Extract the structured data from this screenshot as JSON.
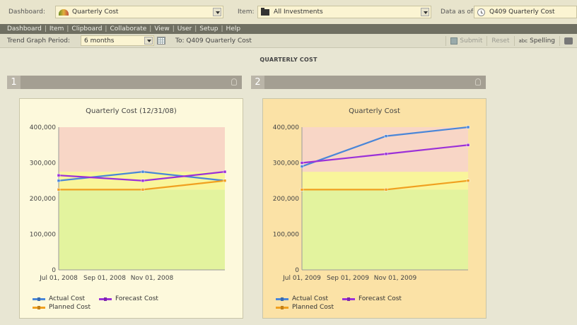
{
  "toolbar": {
    "dashboard_label": "Dashboard:",
    "dashboard_value": "Quarterly Cost",
    "item_label": "Item:",
    "item_value": "All Investments",
    "data_as_of_label": "Data as of:",
    "data_as_of_value": "Q409 Quarterly Cost"
  },
  "menu": [
    "Dashboard",
    "Item",
    "Clipboard",
    "Collaborate",
    "View",
    "User",
    "Setup",
    "Help"
  ],
  "subbar": {
    "trend_label": "Trend Graph Period:",
    "trend_value": "6 months",
    "to_label": "To: Q409 Quarterly Cost",
    "submit": "Submit",
    "reset": "Reset",
    "spelling": "Spelling",
    "spell_icon": "abc"
  },
  "page_title": "QUARTERLY COST",
  "panels": [
    {
      "number": "1"
    },
    {
      "number": "2"
    }
  ],
  "chart_data": [
    {
      "type": "line",
      "title": "Quarterly Cost (12/31/08)",
      "x_tick_labels": [
        "Jul 01, 2008",
        "Sep 01, 2008",
        "Nov 01, 2008"
      ],
      "x_points": [
        "Jul 2008",
        "Sep-Oct 2008",
        "Dec 2008"
      ],
      "ylim": [
        0,
        400000
      ],
      "yticks": [
        "0",
        "100,000",
        "200,000",
        "300,000",
        "400,000"
      ],
      "bands": [
        {
          "name": "green",
          "from": 0,
          "to": 225000,
          "color": "#e3f39e"
        },
        {
          "name": "yellow",
          "from": 225000,
          "to": 275000,
          "color": "#f9f59b"
        },
        {
          "name": "red",
          "from": 275000,
          "to": 400000,
          "color": "#f8d6c6"
        }
      ],
      "series": [
        {
          "name": "Actual Cost",
          "color": "#4a86d8",
          "values": [
            250000,
            275000,
            250000
          ]
        },
        {
          "name": "Forecast Cost",
          "color": "#9b30d8",
          "values": [
            265000,
            250000,
            275000
          ]
        },
        {
          "name": "Planned Cost",
          "color": "#f0a020",
          "values": [
            225000,
            225000,
            250000
          ]
        }
      ]
    },
    {
      "type": "line",
      "title": "Quarterly Cost",
      "x_tick_labels": [
        "Jul 01, 2009",
        "Sep 01, 2009",
        "Nov 01, 2009"
      ],
      "x_points": [
        "Jul 2009",
        "Sep-Oct 2009",
        "Dec 2009"
      ],
      "ylim": [
        0,
        400000
      ],
      "yticks": [
        "0",
        "100,000",
        "200,000",
        "300,000",
        "400,000"
      ],
      "bands": [
        {
          "name": "green",
          "from": 0,
          "to": 225000,
          "color": "#e3f39e"
        },
        {
          "name": "yellow",
          "from": 225000,
          "to": 275000,
          "color": "#f9f59b"
        },
        {
          "name": "red",
          "from": 275000,
          "to": 400000,
          "color": "#f8d6c6"
        }
      ],
      "series": [
        {
          "name": "Actual Cost",
          "color": "#4a86d8",
          "values": [
            290000,
            375000,
            400000
          ]
        },
        {
          "name": "Forecast Cost",
          "color": "#9b30d8",
          "values": [
            300000,
            325000,
            350000
          ]
        },
        {
          "name": "Planned Cost",
          "color": "#f0a020",
          "values": [
            225000,
            225000,
            250000
          ]
        }
      ]
    }
  ]
}
